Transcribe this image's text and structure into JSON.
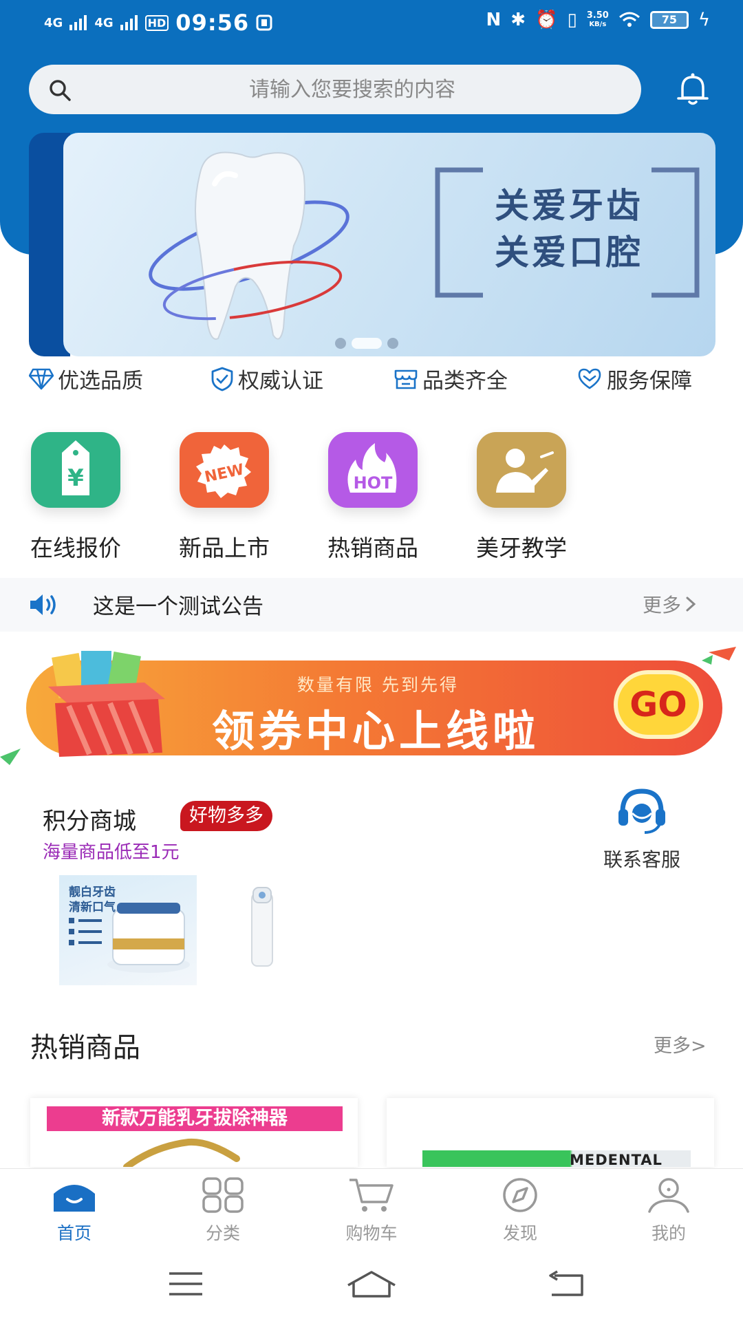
{
  "status_bar": {
    "signal1": "4G",
    "signal2": "4G",
    "hd": "HD",
    "time": "09:56",
    "speed_value": "3.50",
    "speed_unit": "KB/s",
    "battery": "75"
  },
  "search": {
    "placeholder": "请输入您要搜索的内容"
  },
  "banner": {
    "caption_line1": "关爱牙齿",
    "caption_line2": "关爱口腔",
    "slide_count": 3,
    "active_slide": 2
  },
  "features": [
    {
      "label": "优选品质",
      "icon": "diamond-icon"
    },
    {
      "label": "权威认证",
      "icon": "shield-check-icon"
    },
    {
      "label": "品类齐全",
      "icon": "store-icon"
    },
    {
      "label": "服务保障",
      "icon": "heart-shield-icon"
    }
  ],
  "quick_nav": [
    {
      "label": "在线报价",
      "icon": "price-tag-icon",
      "color": "#2fb487"
    },
    {
      "label": "新品上市",
      "icon": "new-badge-icon",
      "color": "#f0643a"
    },
    {
      "label": "热销商品",
      "icon": "hot-flame-icon",
      "color": "#b55ae6"
    },
    {
      "label": "美牙教学",
      "icon": "teacher-icon",
      "color": "#c9a456"
    }
  ],
  "notice": {
    "text": "这是一个测试公告",
    "more": "更多"
  },
  "coupon": {
    "subtitle": "数量有限 先到先得",
    "title": "领券中心上线啦",
    "go": "GO"
  },
  "points_mall": {
    "title": "积分商城",
    "badge": "好物多多",
    "subtitle": "海量商品低至1元",
    "product1_text": "靓白牙齿\n清新口气"
  },
  "service": {
    "label": "联系客服"
  },
  "hot_products": {
    "title": "热销商品",
    "more": "更多>",
    "card1_title": "新款万能乳牙拔除神器",
    "card2_brand": "MEDENTAL"
  },
  "tab_bar": [
    {
      "label": "首页",
      "icon": "home-icon",
      "active": true
    },
    {
      "label": "分类",
      "icon": "category-icon",
      "active": false
    },
    {
      "label": "购物车",
      "icon": "cart-icon",
      "active": false
    },
    {
      "label": "发现",
      "icon": "compass-icon",
      "active": false
    },
    {
      "label": "我的",
      "icon": "user-icon",
      "active": false
    }
  ],
  "colors": {
    "brand_blue": "#0b6fbe",
    "active_tab": "#1a6fc4",
    "badge_red": "#c9171f",
    "subtitle_purple": "#9a2ab6"
  }
}
